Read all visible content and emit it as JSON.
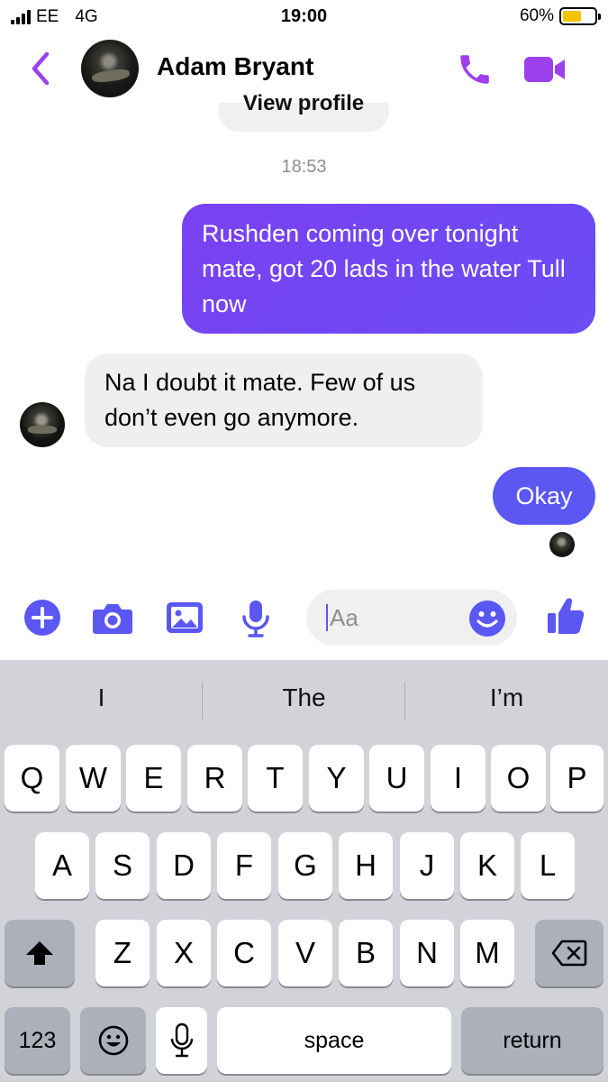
{
  "status_bar": {
    "carrier": "EE",
    "network": "4G",
    "time": "19:00",
    "battery": "60%",
    "battery_level": 0.6,
    "battery_color": "#f2c500"
  },
  "header": {
    "back_icon": "chevron-left-icon",
    "contact_name": "Adam Bryant",
    "call_icon": "phone-icon",
    "video_icon": "video-camera-icon",
    "accent_color": "#9b40ec"
  },
  "conversation": {
    "view_profile_label": "View profile",
    "timestamp": "18:53",
    "messages": [
      {
        "direction": "outgoing",
        "text": "Rushden coming over tonight mate, got 20 lads in the water Tull now"
      },
      {
        "direction": "incoming",
        "text": "Na I doubt it mate. Few of us don’t even go anymore."
      },
      {
        "direction": "outgoing",
        "text": "Okay"
      }
    ],
    "outgoing_color": "#6a4cf5",
    "incoming_color": "#efefef"
  },
  "composer": {
    "icons": [
      "plus-circle-icon",
      "camera-icon",
      "image-icon",
      "microphone-icon",
      "emoji-icon",
      "thumbs-up-icon"
    ],
    "placeholder": "Aa",
    "icon_color": "#5a57f3"
  },
  "keyboard": {
    "suggestions": [
      "I",
      "The",
      "I’m"
    ],
    "row1": [
      "Q",
      "W",
      "E",
      "R",
      "T",
      "Y",
      "U",
      "I",
      "O",
      "P"
    ],
    "row2": [
      "A",
      "S",
      "D",
      "F",
      "G",
      "H",
      "J",
      "K",
      "L"
    ],
    "row3": [
      "Z",
      "X",
      "C",
      "V",
      "B",
      "N",
      "M"
    ],
    "shift_icon": "shift-arrow-icon",
    "backspace_icon": "backspace-icon",
    "numbers_label": "123",
    "emoji_key_icon": "emoji-icon",
    "dictation_icon": "microphone-icon",
    "space_label": "space",
    "return_label": "return"
  }
}
